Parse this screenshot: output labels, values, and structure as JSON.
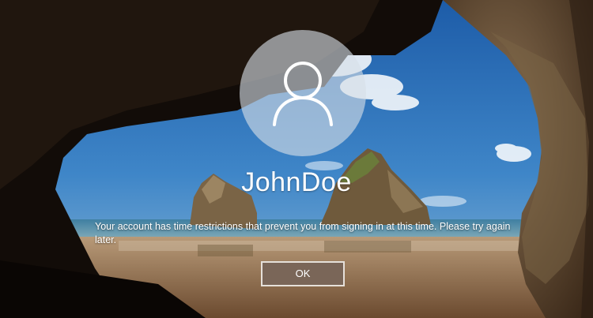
{
  "lockscreen": {
    "background": "cave-beach-wallpaper",
    "avatar_icon": "user-icon",
    "username": "JohnDoe",
    "message": "Your account has time restrictions that prevent you from signing in at this time. Please try again later.",
    "ok_label": "OK"
  },
  "colors": {
    "button_bg": "#7a6658",
    "button_border": "#e6e0da",
    "text": "#ffffff"
  }
}
